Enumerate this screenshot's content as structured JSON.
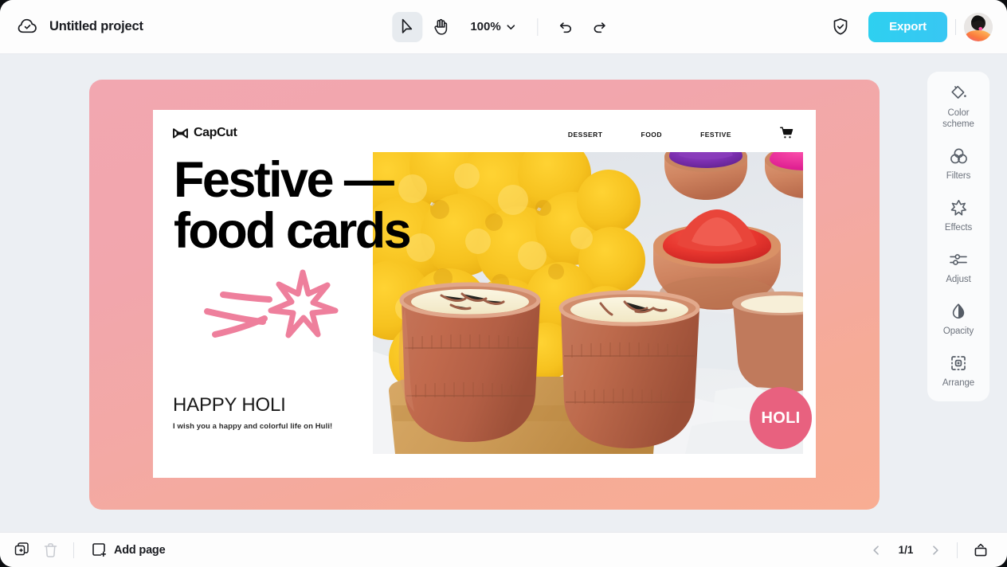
{
  "header": {
    "cloud_icon": "cloud-check-icon",
    "project_title": "Untitled project",
    "tools": [
      {
        "name": "select-tool",
        "icon": "cursor-arrow-icon",
        "active": true
      },
      {
        "name": "hand-tool",
        "icon": "hand-icon",
        "active": false
      }
    ],
    "zoom": {
      "value": "100%",
      "chevron": "chevron-down-icon"
    },
    "undo_icon": "undo-arrow-icon",
    "redo_icon": "redo-arrow-icon",
    "shield_icon": "shield-check-icon",
    "export_label": "Export",
    "export_color": "#2ed0f0",
    "avatar": "user-avatar"
  },
  "canvas": {
    "background_gradient_from": "#f2a7b0",
    "background_gradient_to": "#f8ad93",
    "design": {
      "brand": {
        "name": "CapCut",
        "logo": "capcut-bowtie-logo"
      },
      "nav_links": [
        "DESSERT",
        "FOOD",
        "FESTIVE"
      ],
      "cart_icon": "shopping-cart-icon",
      "headline_line1": "Festive —",
      "headline_line2": "food cards",
      "doodle": "shooting-star-doodle",
      "doodle_color": "#ee7f9c",
      "heading": "HAPPY HOLI",
      "subtext": "I wish you a happy and colorful life on Huli!",
      "badge_label": "HOLI",
      "badge_color": "#e8617f",
      "photo_alt": "holi-festive-food-photo"
    }
  },
  "rail": {
    "items": [
      {
        "label": "Color\nscheme",
        "label_line1": "Color",
        "label_line2": "scheme",
        "icon": "paint-bucket-icon",
        "name": "color-scheme"
      },
      {
        "label": "Filters",
        "icon": "filters-circles-icon",
        "name": "filters"
      },
      {
        "label": "Effects",
        "icon": "effects-star-icon",
        "name": "effects"
      },
      {
        "label": "Adjust",
        "icon": "adjust-sliders-icon",
        "name": "adjust"
      },
      {
        "label": "Opacity",
        "icon": "opacity-droplet-icon",
        "name": "opacity"
      },
      {
        "label": "Arrange",
        "icon": "arrange-frame-icon",
        "name": "arrange"
      }
    ]
  },
  "footer": {
    "duplicate_icon": "duplicate-page-icon",
    "delete_icon": "trash-icon",
    "add_page_icon": "add-page-square-icon",
    "add_page_label": "Add page",
    "prev_icon": "chevron-left-icon",
    "next_icon": "chevron-right-icon",
    "page_indicator": "1/1",
    "present_icon": "present-panel-icon"
  }
}
